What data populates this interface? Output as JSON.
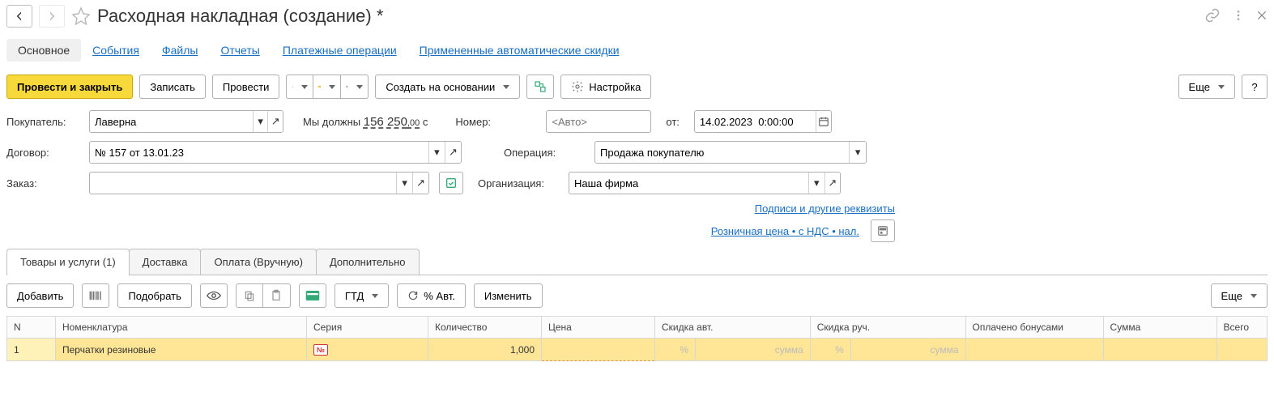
{
  "header": {
    "title": "Расходная накладная (создание) *"
  },
  "nav_tabs": {
    "main": "Основное",
    "events": "События",
    "files": "Файлы",
    "reports": "Отчеты",
    "payment_ops": "Платежные операции",
    "auto_discounts": "Примененные автоматические скидки"
  },
  "toolbar": {
    "post_close": "Провести и закрыть",
    "save": "Записать",
    "post": "Провести",
    "create_based": "Создать на основании",
    "settings": "Настройка",
    "more": "Еще",
    "help": "?"
  },
  "fields": {
    "buyer_label": "Покупатель:",
    "buyer_value": "Лаверна",
    "balance_prefix": "Мы должны",
    "balance_int": "156 250",
    "balance_dec": ",00",
    "balance_cur": "с",
    "number_label": "Номер:",
    "number_placeholder": "<Авто>",
    "date_prefix": "от:",
    "date_value": "14.02.2023  0:00:00",
    "contract_label": "Договор:",
    "contract_value": "№ 157 от 13.01.23",
    "operation_label": "Операция:",
    "operation_value": "Продажа покупателю",
    "order_label": "Заказ:",
    "order_value": "",
    "org_label": "Организация:",
    "org_value": "Наша фирма"
  },
  "links": {
    "signatures": "Подписи и другие реквизиты",
    "price_mode": "Розничная цена • с НДС • нал."
  },
  "detail_tabs": {
    "goods": "Товары и услуги (1)",
    "delivery": "Доставка",
    "payment": "Оплата (Вручную)",
    "extra": "Дополнительно"
  },
  "tab_toolbar": {
    "add": "Добавить",
    "pick": "Подобрать",
    "gtd": "ГТД",
    "auto_pct": "% Авт.",
    "change": "Изменить",
    "more": "Еще"
  },
  "table": {
    "cols": {
      "n": "N",
      "nomenclature": "Номенклатура",
      "series": "Серия",
      "qty": "Количество",
      "price": "Цена",
      "disc_auto": "Скидка авт.",
      "disc_man": "Скидка руч.",
      "bonus": "Оплачено бонусами",
      "sum": "Сумма",
      "total": "Всего"
    },
    "rows": [
      {
        "n": "1",
        "nomenclature": "Перчатки резиновые",
        "series_badge": "№",
        "qty": "1,000",
        "price": "",
        "disc_auto_pct": "%",
        "disc_auto_sum": "сумма",
        "disc_man_pct": "%",
        "disc_man_sum": "сумма"
      }
    ]
  }
}
